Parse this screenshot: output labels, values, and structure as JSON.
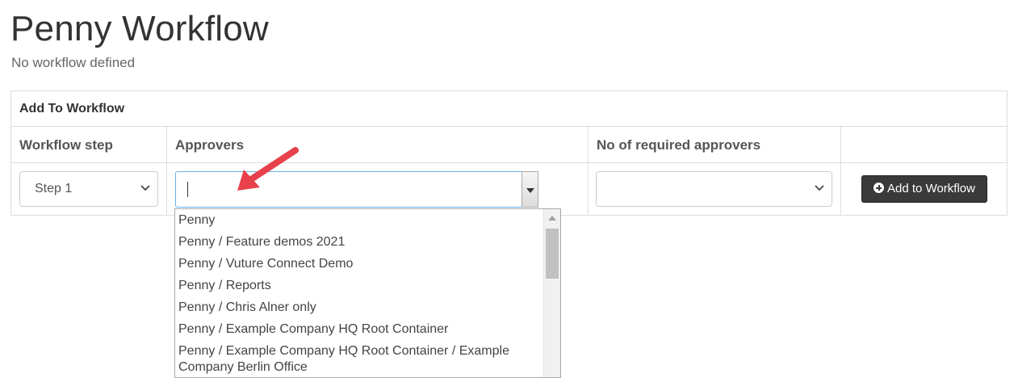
{
  "page": {
    "title": "Penny Workflow",
    "subtitle": "No workflow defined"
  },
  "panel": {
    "heading": "Add To Workflow",
    "columns": [
      "Workflow step",
      "Approvers",
      "No of required approvers",
      ""
    ]
  },
  "workflow_step": {
    "selected": "Step 1"
  },
  "approvers": {
    "value": ""
  },
  "required_approvers": {
    "selected": ""
  },
  "add_button": {
    "label": "Add to Workflow",
    "icon": "plus-circle-icon"
  },
  "dropdown": {
    "items": [
      "Penny",
      "Penny / Feature demos 2021",
      "Penny / Vuture Connect Demo",
      "Penny / Reports",
      "Penny / Chris Alner only",
      "Penny / Example Company HQ Root Container",
      "Penny / Example Company HQ Root Container / Example Company Berlin Office"
    ]
  },
  "annotation": {
    "arrow_color": "#e8414b"
  }
}
